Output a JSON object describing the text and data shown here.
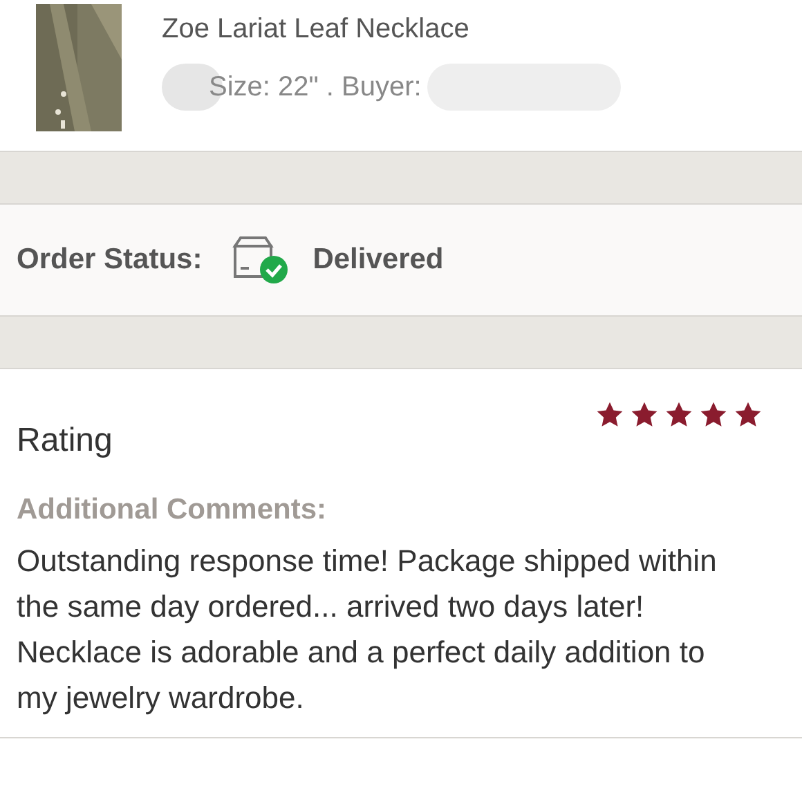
{
  "product": {
    "title": "Zoe Lariat Leaf Necklace",
    "details": "Size: 22\" . Buyer:"
  },
  "order_status": {
    "label": "Order Status:",
    "delivered": true,
    "value": "Delivered"
  },
  "rating": {
    "title": "Rating",
    "stars": 5,
    "comments_label": "Additional Comments:",
    "comments": "Outstanding response time! Package shipped within the same day ordered... arrived two days later! Necklace is adorable and a perfect daily addition to my jewelry wardrobe."
  }
}
